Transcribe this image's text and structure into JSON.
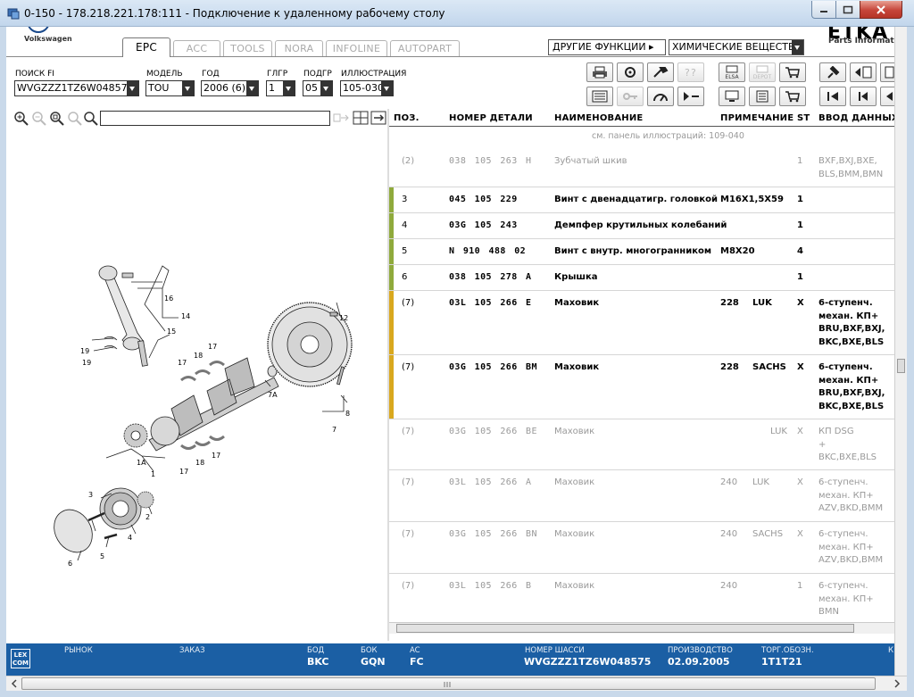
{
  "window": {
    "title": "0-150 - 178.218.221.178:111 - Подключение к удаленному рабочему столу"
  },
  "header": {
    "brand": "Volkswagen",
    "etka_logo": "ETKA",
    "etka_sub": "Parts Informat",
    "tabs": [
      {
        "label": "EPC",
        "active": true
      },
      {
        "label": "ACC",
        "active": false
      },
      {
        "label": "TOOLS",
        "active": false
      },
      {
        "label": "NORA",
        "active": false
      },
      {
        "label": "INFOLINE",
        "active": false
      },
      {
        "label": "AUTOPART",
        "active": false
      }
    ],
    "other_functions": "ДРУГИЕ ФУНКЦИИ ▸",
    "chemicals": "ХИМИЧЕСКИЕ ВЕЩЕСТВА"
  },
  "filters": {
    "vin": {
      "label": "ПОИСК FI",
      "value": "WVGZZZ1TZ6W048575"
    },
    "model": {
      "label": "МОДЕЛЬ",
      "value": "TOU"
    },
    "year": {
      "label": "ГОД",
      "value": "2006 (6)"
    },
    "group": {
      "label": "ГЛГР",
      "value": "1"
    },
    "subgroup": {
      "label": "ПОДГР",
      "value": "05"
    },
    "illustration": {
      "label": "ИЛЛЮСТРАЦИЯ",
      "value": "105-030"
    }
  },
  "toolbar_labels": {
    "elsa": "ELSA",
    "depot": "DEPOT"
  },
  "table": {
    "headers": {
      "pos": "ПОЗ.",
      "part_no": "НОМЕР ДЕТАЛИ",
      "name": "НАИМЕНОВАНИЕ",
      "note": "ПРИМЕЧАНИЕ",
      "st": "ST",
      "input": "ВВОД ДАННЫХ"
    },
    "ref_note": "см. панель иллюстраций:   109-040",
    "rows": [
      {
        "pos": "(2)",
        "part_no": "038 105 263 H",
        "name": "Зубчатый шкив",
        "note": "",
        "note2": "",
        "st": "1",
        "input": "BXF,BXJ,BXE,\nBLS,BMM,BMN",
        "gray": true,
        "bar": ""
      },
      {
        "pos": "3",
        "part_no": "045 105 229",
        "name": "Винт с двенадцатигр. головкой",
        "note": "M16X1,5X59",
        "note2": "",
        "st": "1",
        "input": "",
        "gray": false,
        "bar": "#8faa3c"
      },
      {
        "pos": "4",
        "part_no": "03G 105 243",
        "name": "Демпфер крутильных колебаний",
        "note": "",
        "note2": "",
        "st": "1",
        "input": "",
        "gray": false,
        "bar": "#8faa3c"
      },
      {
        "pos": "5",
        "part_no": "N   910 488 02",
        "name": "Винт с внутр. многогранником",
        "note": "M8X20",
        "note2": "",
        "st": "4",
        "input": "",
        "gray": false,
        "bar": "#8faa3c"
      },
      {
        "pos": "6",
        "part_no": "038 105 278 A",
        "name": "Крышка",
        "note": "",
        "note2": "",
        "st": "1",
        "input": "",
        "gray": false,
        "bar": "#8faa3c"
      },
      {
        "pos": "(7)",
        "part_no": "03L 105 266 E",
        "name": "Маховик",
        "note": "228",
        "note2": "LUK",
        "st": "X",
        "input": "6-ступенч.\nмехан. КП+\nBRU,BXF,BXJ,\nBKC,BXE,BLS",
        "gray": false,
        "bar": "#d9a81e"
      },
      {
        "pos": "(7)",
        "part_no": "03G 105 266 BM",
        "name": "Маховик",
        "note": "228",
        "note2": "SACHS",
        "st": "X",
        "input": "6-ступенч.\nмехан. КП+\nBRU,BXF,BXJ,\nBKC,BXE,BLS",
        "gray": false,
        "bar": "#d9a81e"
      },
      {
        "pos": "(7)",
        "part_no": "03G 105 266 BE",
        "name": "Маховик",
        "note": "",
        "note2": "LUK",
        "st": "X",
        "input": "КП DSG\n+\nBKC,BXE,BLS",
        "gray": true,
        "bar": ""
      },
      {
        "pos": "(7)",
        "part_no": "03L 105 266 A",
        "name": "Маховик",
        "note": "240",
        "note2": "LUK",
        "st": "X",
        "input": "6-ступенч.\nмехан. КП+\nAZV,BKD,BMM",
        "gray": true,
        "bar": ""
      },
      {
        "pos": "(7)",
        "part_no": "03G 105 266 BN",
        "name": "Маховик",
        "note": "240",
        "note2": "SACHS",
        "st": "X",
        "input": "6-ступенч.\nмехан. КП+\nAZV,BKD,BMM",
        "gray": true,
        "bar": ""
      },
      {
        "pos": "(7)",
        "part_no": "03L 105 266 B",
        "name": "Маховик",
        "note": "240",
        "note2": "",
        "st": "1",
        "input": "6-ступенч.\nмехан. КП+\nBMN",
        "gray": true,
        "bar": ""
      }
    ]
  },
  "diagram_labels": [
    "16",
    "14",
    "15",
    "19",
    "19",
    "18",
    "17",
    "17",
    "12",
    "7A",
    "8",
    "7",
    "1A",
    "1",
    "17",
    "18",
    "17",
    "3",
    "2",
    "4",
    "5",
    "6"
  ],
  "status": {
    "logo": "LEX\nCOM",
    "market_label": "РЫНОК",
    "order_label": "ЗАКАЗ",
    "bod_label": "БОД",
    "bod_value": "BKC",
    "bok_label": "БОК",
    "bok_value": "GQN",
    "ac_label": "AC",
    "ac_value": "FC",
    "chassis_label": "НОМЕР ШАССИ",
    "chassis_value": "WVGZZZ1TZ6W048575",
    "prod_label": "ПРОИЗВОДСТВО",
    "prod_value": "02.09.2005",
    "trade_label": "ТОРГ.ОБОЗН.",
    "trade_value": "1T1T21",
    "k_label": "К"
  },
  "colors": {
    "status_bg": "#1b5fa4",
    "bar_green": "#8faa3c",
    "bar_yellow": "#d9a81e"
  }
}
